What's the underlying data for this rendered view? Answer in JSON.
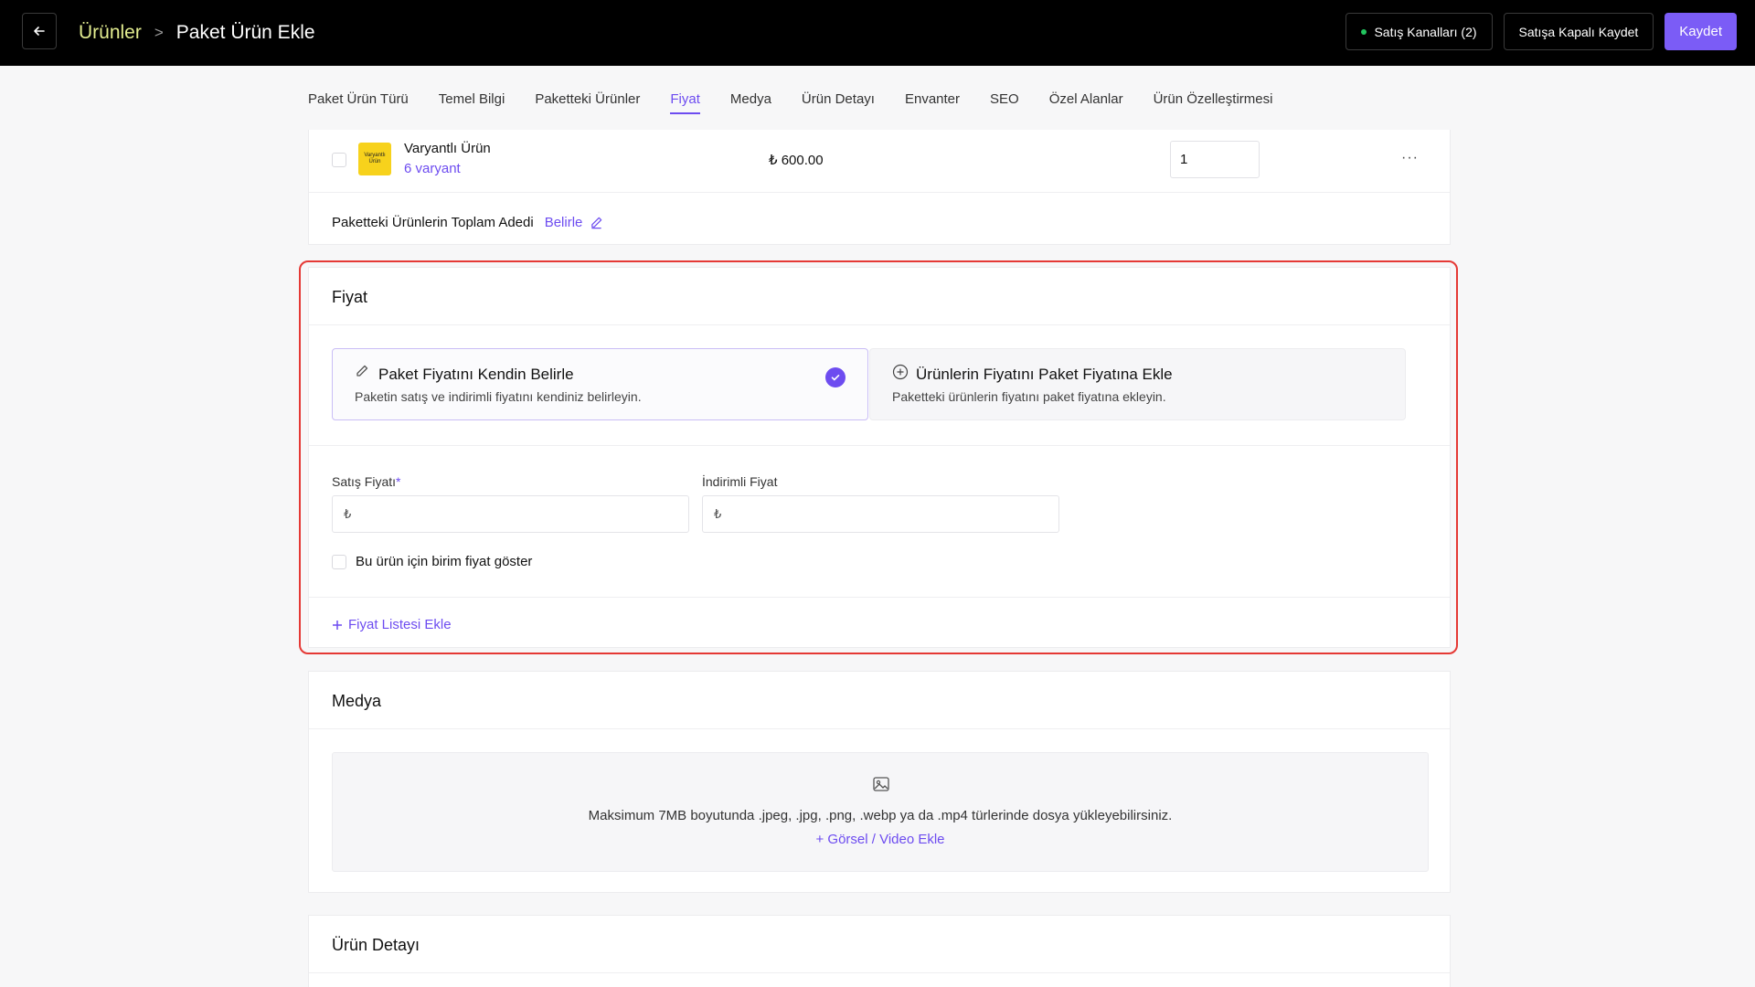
{
  "header": {
    "back_icon": "arrow-left-icon",
    "breadcrumb_parent": "Ürünler",
    "breadcrumb_separator": ">",
    "page_title": "Paket Ürün Ekle",
    "sales_channels_label": "Satış Kanalları (2)",
    "save_closed_label": "Satışa Kapalı Kaydet",
    "save_label": "Kaydet"
  },
  "tabs": [
    {
      "label": "Paket Ürün Türü",
      "active": false
    },
    {
      "label": "Temel Bilgi",
      "active": false
    },
    {
      "label": "Paketteki Ürünler",
      "active": false
    },
    {
      "label": "Fiyat",
      "active": true
    },
    {
      "label": "Medya",
      "active": false
    },
    {
      "label": "Ürün Detayı",
      "active": false
    },
    {
      "label": "Envanter",
      "active": false
    },
    {
      "label": "SEO",
      "active": false
    },
    {
      "label": "Özel Alanlar",
      "active": false
    },
    {
      "label": "Ürün Özelleştirmesi",
      "active": false
    }
  ],
  "bundle_products": {
    "product": {
      "thumb_text": "Varyantlı Ürün",
      "name": "Varyantlı Ürün",
      "variants": "6 varyant",
      "price": "₺ 600.00",
      "quantity": "1",
      "more": "···"
    },
    "total_label": "Paketteki Ürünlerin Toplam Adedi",
    "total_action": "Belirle"
  },
  "price": {
    "title": "Fiyat",
    "option_own": {
      "title": "Paket Fiyatını Kendin Belirle",
      "description": "Paketin satış ve indirimli fiyatını kendiniz belirleyin.",
      "selected": true
    },
    "option_add": {
      "title": "Ürünlerin Fiyatını Paket Fiyatına Ekle",
      "description": "Paketteki ürünlerin fiyatını paket fiyatına ekleyin.",
      "selected": false
    },
    "sale_price_label": "Satış Fiyatı",
    "required_mark": "*",
    "sale_price_prefix": "₺",
    "discount_price_label": "İndirimli Fiyat",
    "discount_price_prefix": "₺",
    "unit_price_label": "Bu ürün için birim fiyat göster",
    "add_price_list": "Fiyat Listesi Ekle"
  },
  "media": {
    "title": "Medya",
    "upload_hint": "Maksimum 7MB boyutunda .jpeg, .jpg, .png, .webp ya da .mp4 türlerinde dosya yükleyebilirsiniz.",
    "upload_action": "Görsel / Video Ekle"
  },
  "product_detail": {
    "title": "Ürün Detayı"
  },
  "colors": {
    "accent": "#6d4cf0",
    "primary_button": "#7b5cf6",
    "breadcrumb": "#e2ec8f",
    "highlight": "#e53935",
    "status_dot": "#22c55e"
  }
}
